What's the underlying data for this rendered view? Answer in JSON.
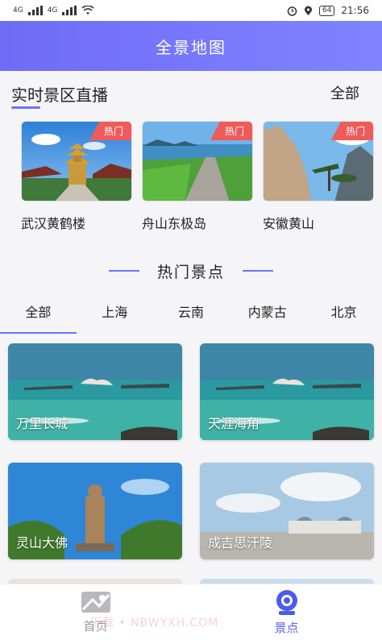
{
  "status_bar": {
    "time": "21:56",
    "battery": "64",
    "network_left": "4G",
    "network_right": "4G"
  },
  "header": {
    "title": "全景地图"
  },
  "live_section": {
    "title": "实时景区直播",
    "all_label": "全部",
    "badge": "热门",
    "items": [
      {
        "name": "武汉黄鹤楼"
      },
      {
        "name": "舟山东极岛"
      },
      {
        "name": "安徽黄山"
      }
    ]
  },
  "hot_section": {
    "title": "热门景点"
  },
  "tabs": [
    "全部",
    "上海",
    "云南",
    "内蒙古",
    "北京"
  ],
  "spots": [
    {
      "name": "万里长城"
    },
    {
      "name": "天涯海角"
    },
    {
      "name": "灵山大佛"
    },
    {
      "name": "成吉思汗陵"
    }
  ],
  "tabbar": {
    "home": "首页",
    "spots": "景点"
  },
  "watermark": "下载 • NBWYXH.COM",
  "colors": {
    "accent": "#6e73ff",
    "badge": "#ef5a5a",
    "header_start": "#6e6cf6",
    "header_end": "#7f83ff"
  }
}
